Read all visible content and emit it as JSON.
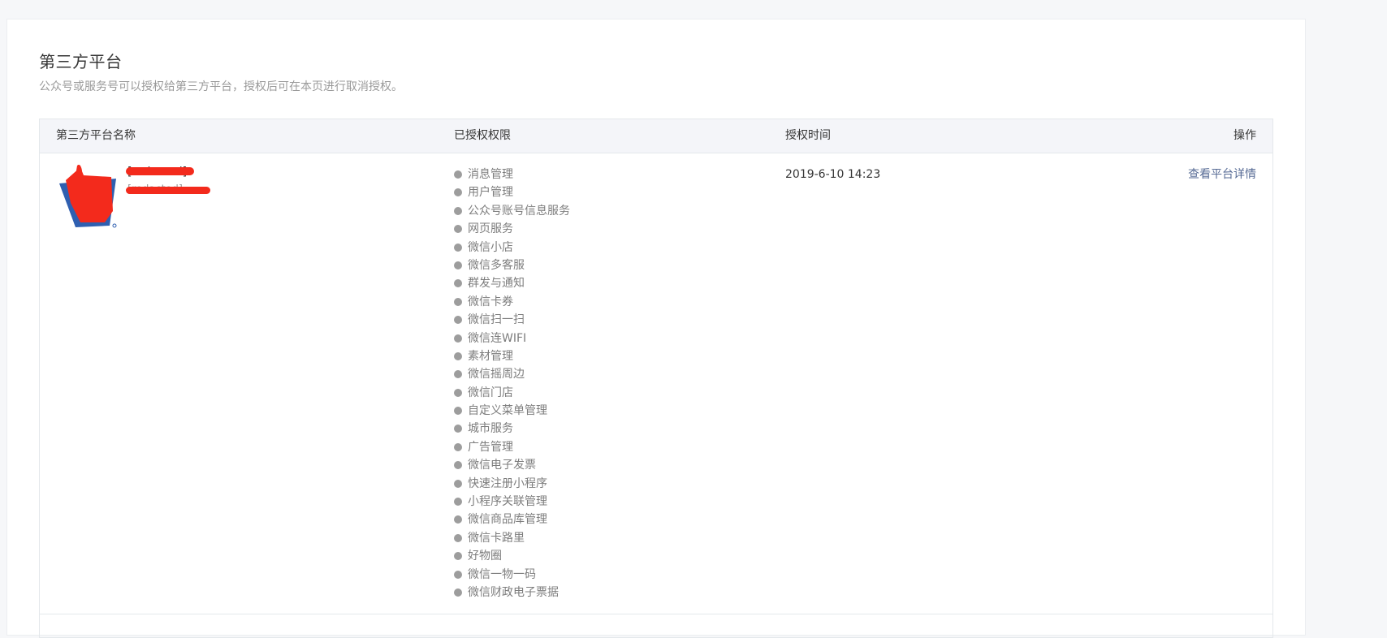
{
  "page": {
    "title": "第三方平台",
    "description": "公众号或服务号可以授权给第三方平台，授权后可在本页进行取消授权。"
  },
  "table": {
    "headers": {
      "name": "第三方平台名称",
      "permissions": "已授权权限",
      "time": "授权时间",
      "operation": "操作"
    },
    "rows": [
      {
        "platform_name": "[redacted]",
        "platform_sub": "[redacted]",
        "permissions": [
          "消息管理",
          "用户管理",
          "公众号账号信息服务",
          "网页服务",
          "微信小店",
          "微信多客服",
          "群发与通知",
          "微信卡券",
          "微信扫一扫",
          "微信连WIFI",
          "素材管理",
          "微信摇周边",
          "微信门店",
          "自定义菜单管理",
          "城市服务",
          "广告管理",
          "微信电子发票",
          "快速注册小程序",
          "小程序关联管理",
          "微信商品库管理",
          "微信卡路里",
          "好物圈",
          "微信一物一码",
          "微信财政电子票据"
        ],
        "auth_time": "2019-6-10 14:23",
        "action_label": "查看平台详情"
      }
    ]
  },
  "colors": {
    "link": "#576b95",
    "redaction": "#f32a1c",
    "logo_blue": "#2f5fb0"
  },
  "icons": {
    "avatar": "platform-logo-icon",
    "bullet": "permission-bullet-icon"
  }
}
